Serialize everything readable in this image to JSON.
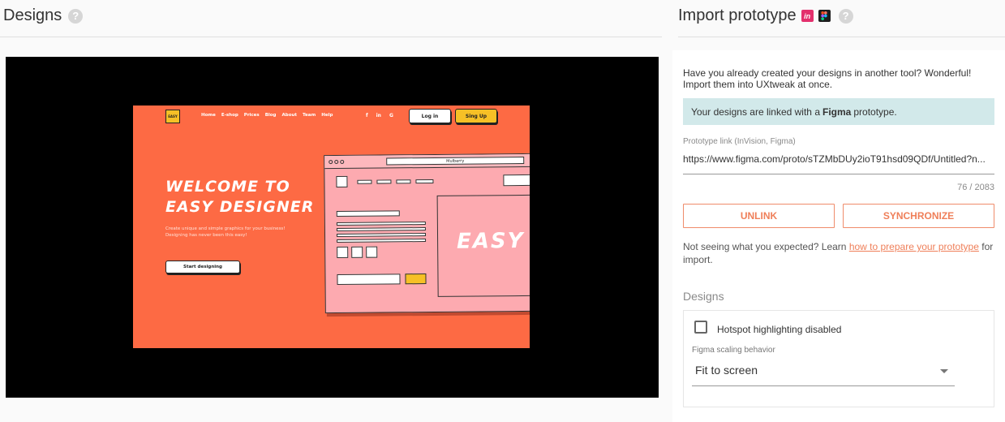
{
  "designs": {
    "title": "Designs",
    "help": "?",
    "preview": {
      "logo": "EASY",
      "nav": [
        "Home",
        "E-shop",
        "Prices",
        "Blog",
        "About",
        "Team",
        "Help"
      ],
      "social": [
        "f",
        "in",
        "G"
      ],
      "login": "Log in",
      "signup": "Sing Up",
      "headline": "Welcome to EASY designer",
      "subtitle": "Create unique and simple graphics for your business! Designing has never been this easy!",
      "start_button": "Start designing",
      "browser_url": "Mulberry",
      "browser_hero_text": "Easy",
      "colors": {
        "background": "#fd6a44",
        "accent": "#f6c026",
        "pink": "#fdaab0"
      }
    }
  },
  "import": {
    "title": "Import prototype",
    "help": "?",
    "invision_icon_label": "in",
    "intro": "Have you already created your designs in another tool? Wonderful! Import them into UXtweak at once.",
    "linked_prefix": "Your designs are linked with a",
    "linked_tool": "Figma",
    "linked_suffix": "prototype.",
    "link_label": "Prototype link (InVision, Figma)",
    "link_value": "https://www.figma.com/proto/sTZMbDUy2ioT91hsd09QDf/Untitled?n...",
    "counter": "76 / 2083",
    "unlink": "UNLINK",
    "synchronize": "SYNCHRONIZE",
    "note_prefix": "Not seeing what you expected? Learn",
    "note_link": "how to prepare your prototype",
    "note_suffix": "for import.",
    "accent_color": "#ef7f59"
  },
  "settings": {
    "section": "Designs",
    "hotspot_label": "Hotspot highlighting disabled",
    "hotspot_checked": false,
    "scaling_label": "Figma scaling behavior",
    "scaling_value": "Fit to screen"
  }
}
